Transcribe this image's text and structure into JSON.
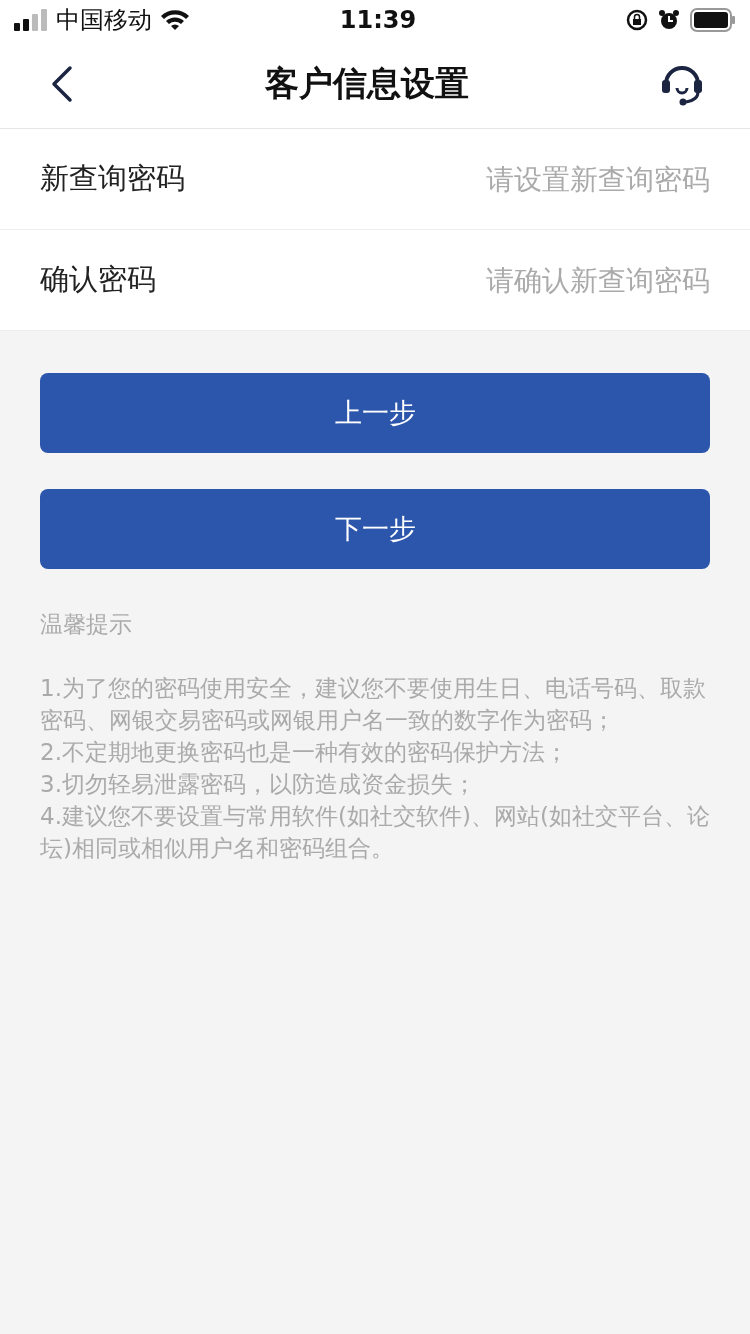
{
  "status_bar": {
    "carrier": "中国移动",
    "time": "11:39"
  },
  "nav": {
    "title": "客户信息设置"
  },
  "fields": [
    {
      "label": "新查询密码",
      "placeholder": "请设置新查询密码"
    },
    {
      "label": "确认密码",
      "placeholder": "请确认新查询密码"
    }
  ],
  "buttons": [
    {
      "label": "上一步"
    },
    {
      "label": "下一步"
    }
  ],
  "tips": {
    "title": "温馨提示",
    "items": [
      "1.为了您的密码使用安全，建议您不要使用生日、电话号码、取款密码、网银交易密码或网银用户名一致的数字作为密码；",
      "2.不定期地更换密码也是一种有效的密码保护方法；",
      "3.切勿轻易泄露密码，以防造成资金损失；",
      "4.建议您不要设置与常用软件(如社交软件)、网站(如社交平台、论坛)相同或相似用户名和密码组合。"
    ]
  }
}
